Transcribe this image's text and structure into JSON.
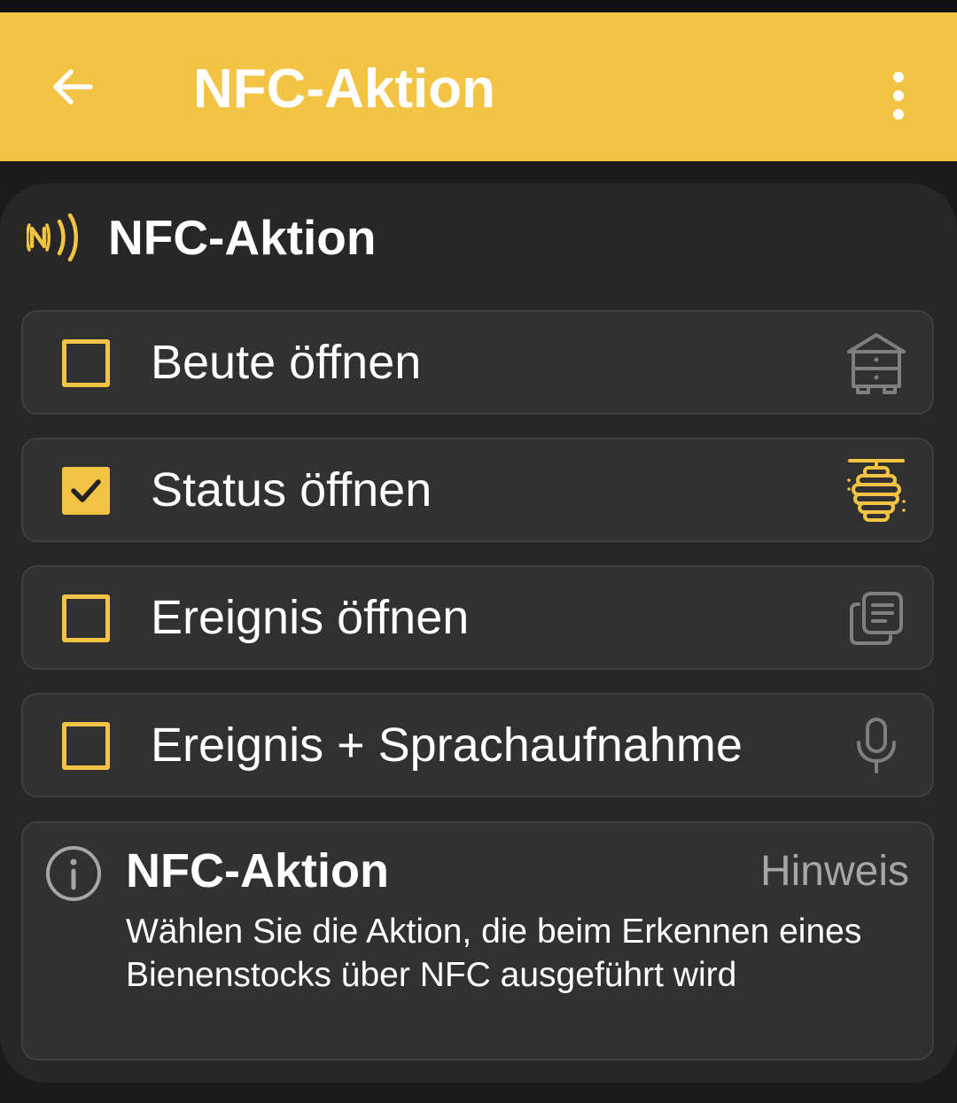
{
  "app_bar": {
    "title": "NFC-Aktion",
    "back_icon": "arrow-left-icon",
    "menu_icon": "more-vertical-icon",
    "background_color": "#f3c343"
  },
  "card": {
    "title": "NFC-Aktion",
    "icon": "nfc-icon",
    "options": [
      {
        "label": "Beute öffnen",
        "checked": false,
        "icon": "beehive-box-icon"
      },
      {
        "label": "Status öffnen",
        "checked": true,
        "icon": "beehive-skep-icon"
      },
      {
        "label": "Ereignis öffnen",
        "checked": false,
        "icon": "documents-icon"
      },
      {
        "label": "Ereignis + Sprachaufnahme",
        "checked": false,
        "icon": "microphone-icon"
      }
    ]
  },
  "info": {
    "icon": "info-icon",
    "title": "NFC-Aktion",
    "tag": "Hinweis",
    "text": "Wählen Sie die Aktion, die beim Erkennen eines Bienenstocks über NFC ausgeführt wird"
  },
  "colors": {
    "accent": "#f3c343",
    "card_background": "#272727",
    "option_background": "#313131",
    "muted_icon": "#808080"
  }
}
